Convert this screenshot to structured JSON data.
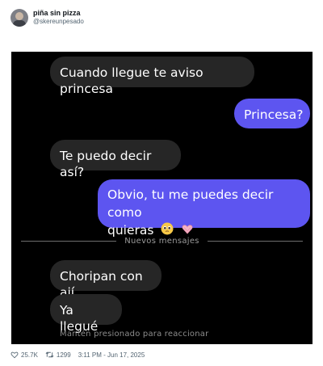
{
  "tweet": {
    "display_name": "piña sin pizza",
    "handle": "@skereunpesado"
  },
  "chat": {
    "messages": [
      {
        "side": "in",
        "text": "Cuando llegue te aviso princesa"
      },
      {
        "side": "out",
        "text": "Princesa?"
      },
      {
        "side": "in",
        "text": "Te puedo decir así?"
      },
      {
        "side": "out",
        "text_line1": "Obvio, tu me puedes decir como",
        "text_line2": "quieras"
      },
      {
        "side": "in",
        "text": "Choripan con ají"
      },
      {
        "side": "in",
        "text": "Ya llegué"
      }
    ],
    "divider_label": "Nuevos mensajes",
    "hint": "Mantén presionado para reaccionar",
    "emojis": [
      "pleading-face-emoji",
      "heart-hands-emoji"
    ]
  },
  "footer": {
    "likes": "25.7K",
    "retweets": "1299",
    "timestamp": "3:11 PM - Jun 17, 2025",
    "icons": [
      "heart-icon",
      "retweet-icon"
    ]
  }
}
